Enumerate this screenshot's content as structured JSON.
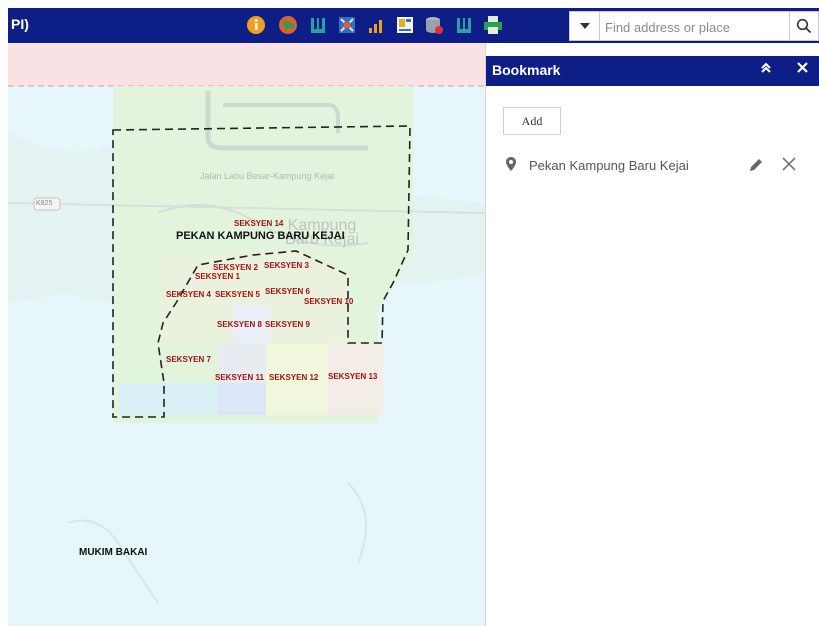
{
  "app": {
    "title_fragment": "PI)"
  },
  "toolbar": {
    "tools": [
      {
        "icon": "info-icon",
        "color": "#f0a020"
      },
      {
        "icon": "globe-icon",
        "color": "#e06030"
      },
      {
        "icon": "bookmark-list-icon",
        "color": "#2aa0a0"
      },
      {
        "icon": "map-layers-icon",
        "color": "#3070c0"
      },
      {
        "icon": "bar-chart-icon",
        "color": "#f0a020"
      },
      {
        "icon": "legend-icon",
        "color": "#e0b020"
      },
      {
        "icon": "database-icon",
        "color": "#9aa0aa"
      },
      {
        "icon": "bookmark-icon",
        "color": "#2aa0a0"
      },
      {
        "icon": "print-icon",
        "color": "#2aa050"
      }
    ]
  },
  "search": {
    "placeholder": "Find address or place",
    "value": ""
  },
  "panel": {
    "title": "Bookmark",
    "add_label": "Add",
    "bookmarks": [
      {
        "name": "Pekan Kampung Baru Kejai"
      }
    ]
  },
  "map": {
    "road_label": "Jalan Labu Besar-Kampung Kejai",
    "road_shield": "K825",
    "town_label": "PEKAN KAMPUNG BARU KEJAI",
    "basemap_place": "Kampung Baru Kejai",
    "mukim_label": "MUKIM BAKAI",
    "sections": [
      "SEKSYEN 14",
      "SEKSYEN 2",
      "SEKSYEN 3",
      "SEKSYEN 1",
      "SEKSYEN 4",
      "SEKSYEN 5",
      "SEKSYEN 6",
      "SEKSYEN 10",
      "SEKSYEN 8",
      "SEKSYEN 9",
      "SEKSYEN 7",
      "SEKSYEN 11",
      "SEKSYEN 12",
      "SEKSYEN 13"
    ],
    "colors": {
      "boundary": "#222222",
      "section_label": "#a81010",
      "water": "#e6f6fb",
      "land_highlight": "#dff3da"
    }
  }
}
